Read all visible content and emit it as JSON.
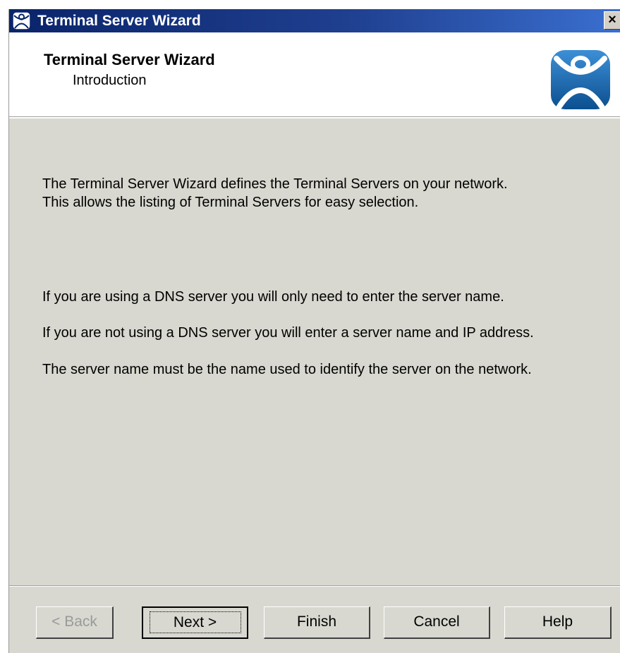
{
  "window": {
    "title": "Terminal Server Wizard",
    "close_label": "×"
  },
  "header": {
    "title": "Terminal Server Wizard",
    "subtitle": "Introduction",
    "logo_icon": "thinmanager-person-logo-icon"
  },
  "content": {
    "paragraph1_line1": "The Terminal Server Wizard defines the Terminal Servers on your network.",
    "paragraph1_line2": "This allows the listing of Terminal Servers for easy selection.",
    "paragraph2": "If you are using a DNS server you will only need to enter the server name.",
    "paragraph3": "If you are not using a DNS server you will enter a server name and IP address.",
    "paragraph4": "The server name must be the name used to identify the server on the network."
  },
  "buttons": {
    "back": "< Back",
    "next": "Next >",
    "finish": "Finish",
    "cancel": "Cancel",
    "help": "Help"
  },
  "colors": {
    "titlebar": "#0a246a",
    "dialog_bg": "#d8d8d0",
    "logo_blue": "#1a6fb8"
  }
}
